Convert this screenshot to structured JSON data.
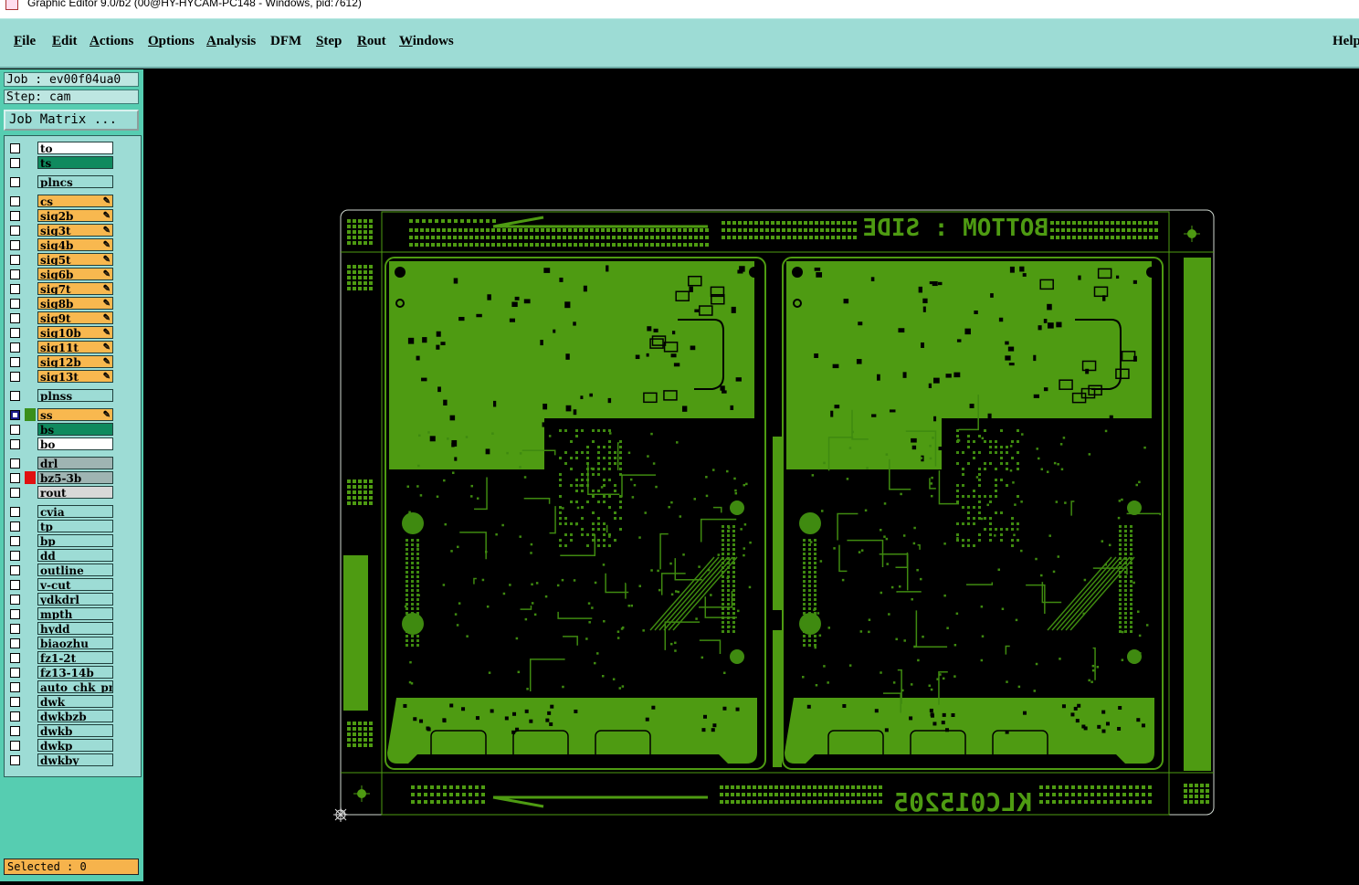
{
  "window": {
    "title": "Graphic Editor 9.0/b2 (00@HY-HYCAM-PC148 - Windows, pid:7612)"
  },
  "menu": {
    "items": [
      "File",
      "Edit",
      "Actions",
      "Options",
      "Analysis",
      "DFM",
      "Step",
      "Rout",
      "Windows"
    ],
    "help": "Help"
  },
  "job": {
    "label": "Job : ev00f04ua0",
    "step": "Step: cam",
    "matrix_button": "Job Matrix ..."
  },
  "layers": [
    {
      "name": "to",
      "color": "#ffffff",
      "checked": false,
      "edit": false
    },
    {
      "name": "ts",
      "color": "#0f8a5e",
      "checked": false,
      "edit": false
    },
    {
      "name": "plncs",
      "color": "#9ddcd5",
      "checked": false,
      "edit": false
    },
    {
      "name": "cs",
      "color": "#f8b84f",
      "checked": false,
      "edit": true
    },
    {
      "name": "sig2b",
      "color": "#f8b84f",
      "checked": false,
      "edit": true
    },
    {
      "name": "sig3t",
      "color": "#f8b84f",
      "checked": false,
      "edit": true
    },
    {
      "name": "sig4b",
      "color": "#f8b84f",
      "checked": false,
      "edit": true
    },
    {
      "name": "sig5t",
      "color": "#f8b84f",
      "checked": false,
      "edit": true
    },
    {
      "name": "sig6b",
      "color": "#f8b84f",
      "checked": false,
      "edit": true
    },
    {
      "name": "sig7t",
      "color": "#f8b84f",
      "checked": false,
      "edit": true
    },
    {
      "name": "sig8b",
      "color": "#f8b84f",
      "checked": false,
      "edit": true
    },
    {
      "name": "sig9t",
      "color": "#f8b84f",
      "checked": false,
      "edit": true
    },
    {
      "name": "sig10b",
      "color": "#f8b84f",
      "checked": false,
      "edit": true
    },
    {
      "name": "sig11t",
      "color": "#f8b84f",
      "checked": false,
      "edit": true
    },
    {
      "name": "sig12b",
      "color": "#f8b84f",
      "checked": false,
      "edit": true
    },
    {
      "name": "sig13t",
      "color": "#f8b84f",
      "checked": false,
      "edit": true
    },
    {
      "name": "plnss",
      "color": "#9ddcd5",
      "checked": false,
      "edit": false
    },
    {
      "name": "ss",
      "color": "#f8b84f",
      "checked": true,
      "edit": true,
      "mark": "#3a8f1a"
    },
    {
      "name": "bs",
      "color": "#0f8a5e",
      "checked": false,
      "edit": false
    },
    {
      "name": "bo",
      "color": "#ffffff",
      "checked": false,
      "edit": false
    },
    {
      "name": "drl",
      "color": "#9fb4b2",
      "checked": false,
      "edit": false
    },
    {
      "name": "bz5-3b",
      "color": "#9fb4b2",
      "checked": false,
      "edit": false,
      "mark": "#e01010"
    },
    {
      "name": "rout",
      "color": "#d8d8d8",
      "checked": false,
      "edit": false
    },
    {
      "name": "cvia",
      "color": "#9ddcd5",
      "checked": false,
      "edit": false
    },
    {
      "name": "tp",
      "color": "#9ddcd5",
      "checked": false,
      "edit": false
    },
    {
      "name": "bp",
      "color": "#9ddcd5",
      "checked": false,
      "edit": false
    },
    {
      "name": "dd",
      "color": "#9ddcd5",
      "checked": false,
      "edit": false
    },
    {
      "name": "outline",
      "color": "#9ddcd5",
      "checked": false,
      "edit": false
    },
    {
      "name": "v-cut",
      "color": "#9ddcd5",
      "checked": false,
      "edit": false
    },
    {
      "name": "ydkdrl",
      "color": "#9ddcd5",
      "checked": false,
      "edit": false
    },
    {
      "name": "mpth",
      "color": "#9ddcd5",
      "checked": false,
      "edit": false
    },
    {
      "name": "hydd",
      "color": "#9ddcd5",
      "checked": false,
      "edit": false
    },
    {
      "name": "biaozhu",
      "color": "#9ddcd5",
      "checked": false,
      "edit": false
    },
    {
      "name": "fz1-2t",
      "color": "#9ddcd5",
      "checked": false,
      "edit": false
    },
    {
      "name": "fz13-14b",
      "color": "#9ddcd5",
      "checked": false,
      "edit": false
    },
    {
      "name": "auto_chk_pnl",
      "color": "#9ddcd5",
      "checked": false,
      "edit": false
    },
    {
      "name": "dwk",
      "color": "#9ddcd5",
      "checked": false,
      "edit": false
    },
    {
      "name": "dwkbzb",
      "color": "#9ddcd5",
      "checked": false,
      "edit": false
    },
    {
      "name": "dwkb",
      "color": "#9ddcd5",
      "checked": false,
      "edit": false
    },
    {
      "name": "dwkp",
      "color": "#9ddcd5",
      "checked": false,
      "edit": false
    },
    {
      "name": "dwkby",
      "color": "#9ddcd5",
      "checked": false,
      "edit": false
    }
  ],
  "status": {
    "selected": "Selected : 0"
  },
  "board": {
    "top_text": "BOTTOM : SIDE",
    "bottom_text": "KLC015205",
    "copper_color": "#4e9b12",
    "trace_color": "#3f8a10"
  }
}
